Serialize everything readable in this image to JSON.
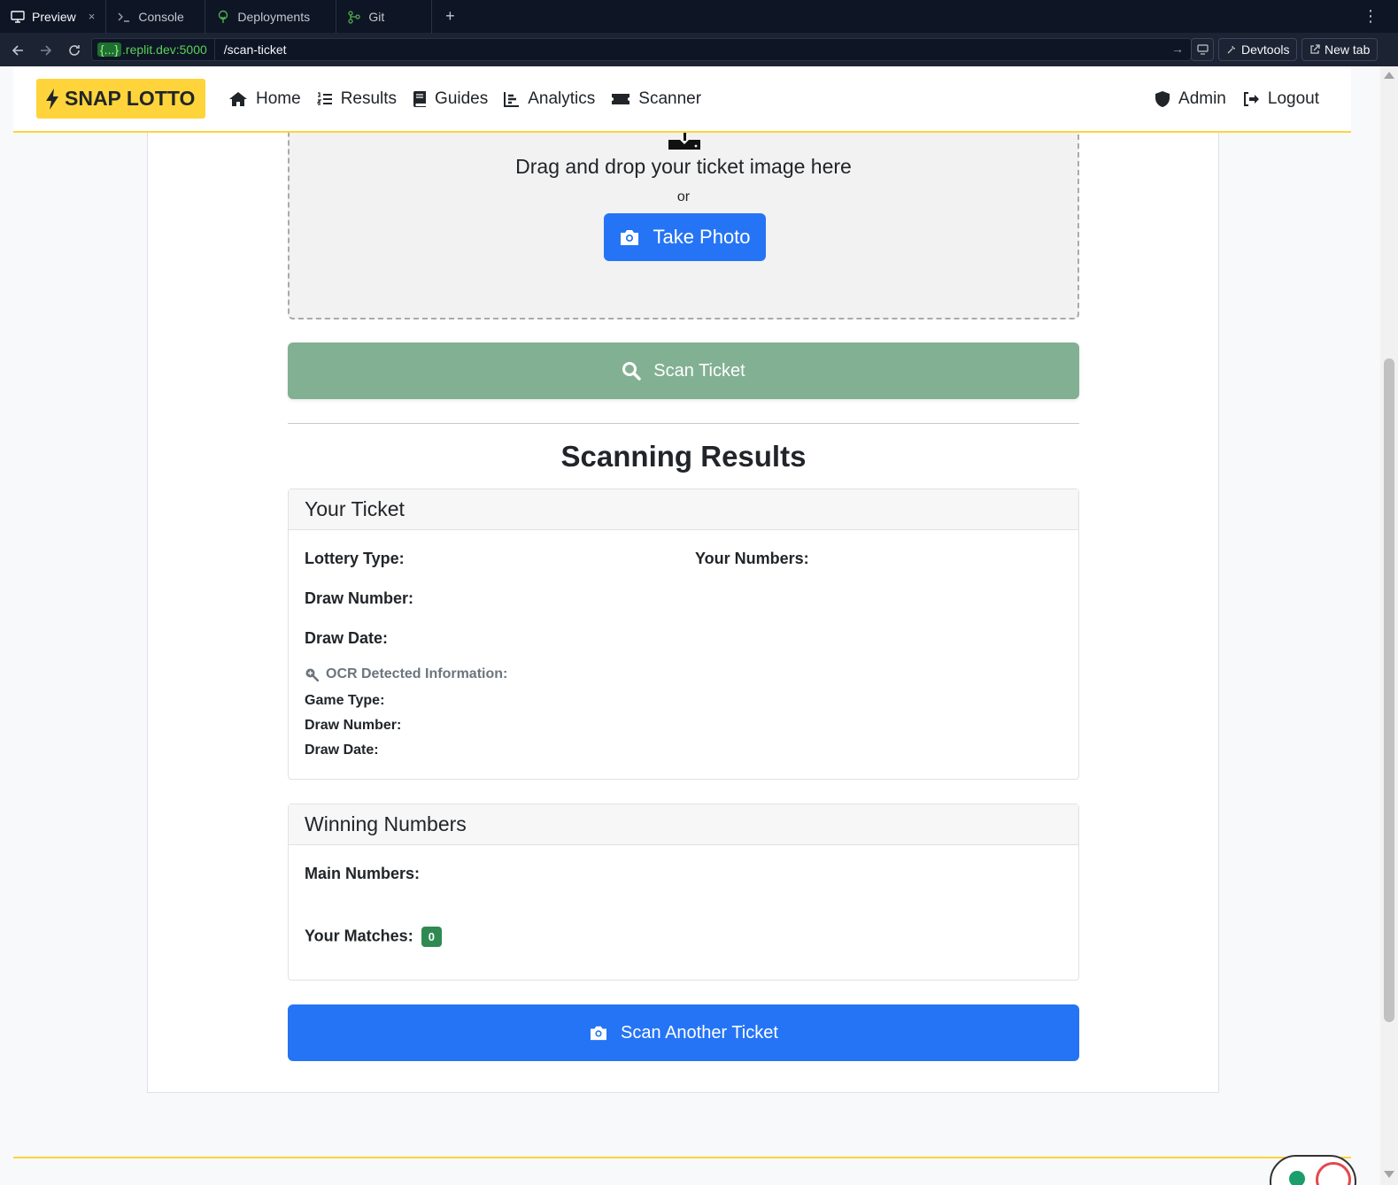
{
  "ide": {
    "tabs": [
      {
        "label": "Preview",
        "close": "×"
      },
      {
        "label": "Console"
      },
      {
        "label": "Deployments"
      },
      {
        "label": "Git"
      }
    ],
    "add_tab": "+",
    "menu": "⋮",
    "url_host_chip": "{...}",
    "url_host": ".replit.dev:5000",
    "url_path": "/scan-ticket",
    "devtools_label": "Devtools",
    "newtab_label": "New tab"
  },
  "nav": {
    "brand": "SNAP LOTTO",
    "links": [
      {
        "label": "Home",
        "icon": "home-icon"
      },
      {
        "label": "Results",
        "icon": "list-ol-icon"
      },
      {
        "label": "Guides",
        "icon": "book-icon"
      },
      {
        "label": "Analytics",
        "icon": "chart-icon"
      },
      {
        "label": "Scanner",
        "icon": "ticket-icon"
      }
    ],
    "admin": "Admin",
    "logout": "Logout"
  },
  "upload": {
    "title": "Drag and drop your ticket image here",
    "or": "or",
    "take_photo": "Take Photo"
  },
  "scan_button": "Scan Ticket",
  "results": {
    "heading": "Scanning Results",
    "your_ticket": {
      "title": "Your Ticket",
      "lottery_type": "Lottery Type:",
      "draw_number": "Draw Number:",
      "draw_date": "Draw Date:",
      "your_numbers": "Your Numbers:",
      "ocr_heading": "OCR Detected Information:",
      "ocr_game_type": "Game Type:",
      "ocr_draw_number": "Draw Number:",
      "ocr_draw_date": "Draw Date:"
    },
    "winning": {
      "title": "Winning Numbers",
      "main_numbers": "Main Numbers:",
      "your_matches": "Your Matches:",
      "match_count": "0"
    }
  },
  "scan_another": "Scan Another Ticket",
  "colors": {
    "brand_yellow": "#ffd43b",
    "primary_blue": "#2574f5",
    "scan_green": "#82b093",
    "badge_green": "#2f8a52"
  }
}
